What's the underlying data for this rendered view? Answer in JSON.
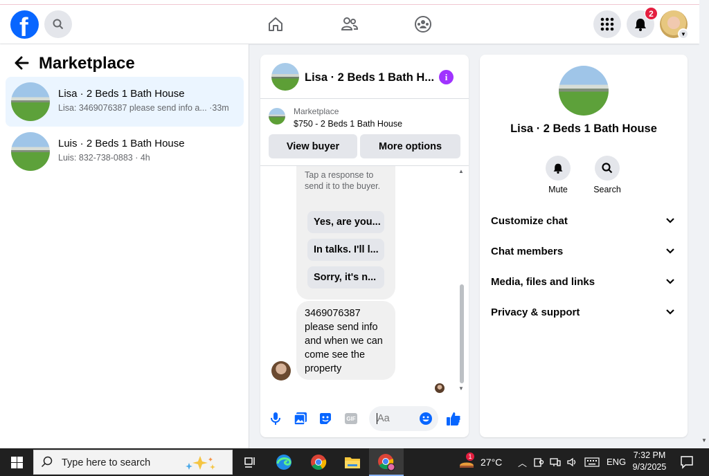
{
  "app": {
    "accent": "#0866ff",
    "notification_count": "2"
  },
  "left": {
    "title": "Marketplace",
    "conversations": [
      {
        "name": "Lisa · 2 Beds 1 Bath House",
        "preview": "Lisa: 3469076387 please send info a... ·33m"
      },
      {
        "name": "Luis · 2 Beds 1 Bath House",
        "preview": "Luis: 832-738-0883 · 4h"
      }
    ]
  },
  "chat": {
    "title": "Lisa · 2 Beds 1 Bath H...",
    "listing_label": "Marketplace",
    "listing_price": "$750 - 2 Beds 1 Bath House",
    "view_buyer": "View buyer",
    "more_options": "More options",
    "hint": "Tap a response to send it to the buyer.",
    "quick_replies": [
      "Yes, are you...",
      "In talks. I'll l...",
      "Sorry, it's n..."
    ],
    "message": "3469076387 please send info and when we can come see the property",
    "composer_placeholder": "Aa"
  },
  "info": {
    "title": "Lisa · 2 Beds 1 Bath House",
    "mute_label": "Mute",
    "search_label": "Search",
    "sections": [
      "Customize chat",
      "Chat members",
      "Media, files and links",
      "Privacy & support"
    ]
  },
  "taskbar": {
    "search_placeholder": "Type here to search",
    "weather": "27°C",
    "language": "ENG",
    "time": "7:32 PM",
    "date": "9/3/2025",
    "weather_badge": "1"
  }
}
